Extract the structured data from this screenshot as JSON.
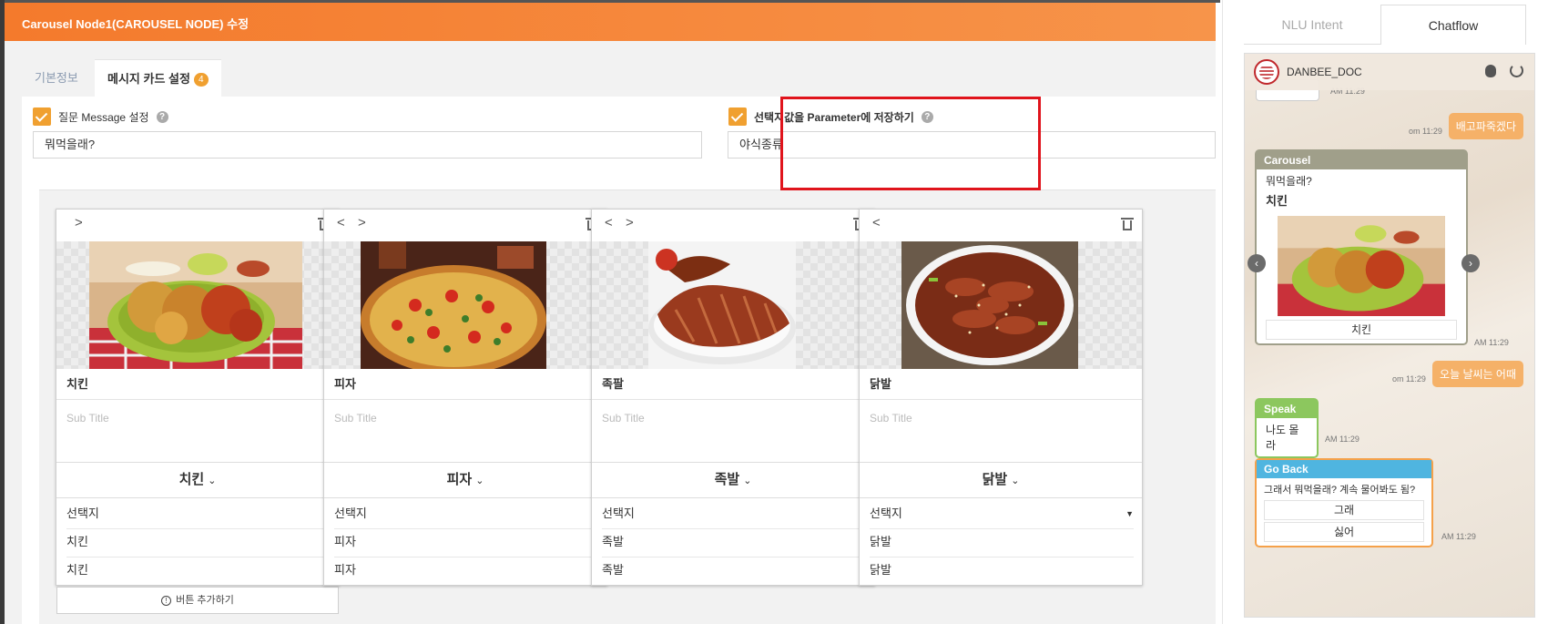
{
  "editor": {
    "title": "Carousel Node1(CAROUSEL NODE) 수정",
    "tabs": [
      {
        "label": "기본정보",
        "active": false
      },
      {
        "label": "메시지 카드 설정",
        "active": true,
        "badge": "4"
      }
    ],
    "question_message": {
      "label": "질문 Message 설정",
      "checked": true,
      "value": "뭐먹을래?"
    },
    "save_parameter": {
      "label": "선택지값을 Parameter에 저장하기",
      "checked": true,
      "value": "야식종류"
    },
    "cards": [
      {
        "title": "치킨",
        "subtitle_placeholder": "Sub Title",
        "dropdown": "치킨",
        "choice_header": "선택지",
        "choice_rows": [
          "치킨",
          "치킨"
        ],
        "nav": [
          ">"
        ],
        "image": "fried-chicken"
      },
      {
        "title": "피자",
        "subtitle_placeholder": "Sub Title",
        "dropdown": "피자",
        "choice_header": "선택지",
        "choice_rows": [
          "피자",
          "피자"
        ],
        "nav": [
          "<",
          ">"
        ],
        "image": "pizza"
      },
      {
        "title": "족팔",
        "subtitle_placeholder": "Sub Title",
        "dropdown": "족발",
        "choice_header": "선택지",
        "choice_rows": [
          "족발",
          "족발"
        ],
        "nav": [
          "<",
          ">"
        ],
        "image": "pork-trotters"
      },
      {
        "title": "닭발",
        "subtitle_placeholder": "Sub Title",
        "dropdown": "닭발",
        "choice_header": "선택지",
        "choice_rows": [
          "닭발",
          "닭발"
        ],
        "nav": [
          "<"
        ],
        "image": "spicy-chicken-feet"
      }
    ],
    "add_button_label": "버튼 추가하기"
  },
  "chat": {
    "tabs": [
      {
        "label": "NLU Intent",
        "active": false
      },
      {
        "label": "Chatflow",
        "active": true
      }
    ],
    "bot_name": "DANBEE_DOC",
    "messages": {
      "top_time": "AM 11:29",
      "user1": {
        "text": "배고파죽겠다",
        "time": "om 11:29"
      },
      "carousel": {
        "header": "Carousel",
        "question": "뭐먹을래?",
        "title": "치킨",
        "button": "치킨",
        "time": "AM 11:29"
      },
      "user2": {
        "text": "오늘 날씨는 어때",
        "time": "om 11:29"
      },
      "speak": {
        "header": "Speak",
        "text": "나도 몰라",
        "time": "AM 11:29"
      },
      "goback": {
        "header": "Go Back",
        "text": "그래서 뭐먹을래? 계속 물어봐도 됨?",
        "buttons": [
          "그래",
          "싫어"
        ],
        "time": "AM 11:29"
      }
    },
    "colors": {
      "user_bubble": "#f5b168",
      "carousel_head": "#a09f8a",
      "speak_head": "#8cc75e",
      "goback_head": "#4fb5e0",
      "goback_border": "#f5a14a"
    }
  },
  "colors": {
    "accent": "#f47a2c",
    "checkbox": "#f0a030",
    "highlight": "#e0141c"
  }
}
